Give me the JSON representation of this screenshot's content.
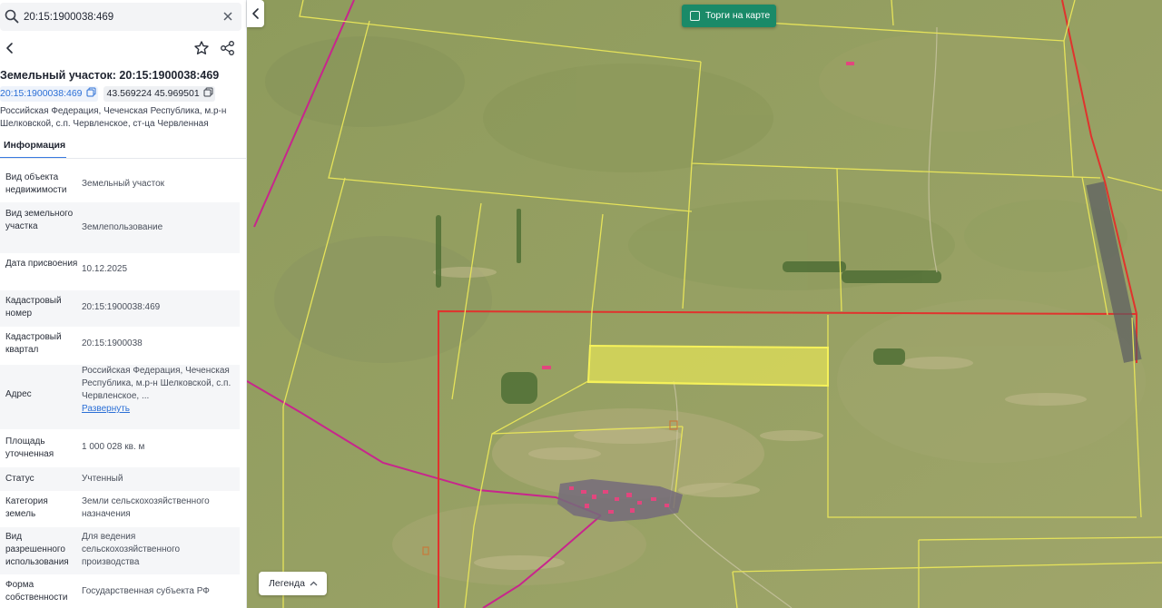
{
  "search": {
    "query": "20:15:1900038:469"
  },
  "card": {
    "title": "Земельный участок: 20:15:1900038:469",
    "cadastral_chip": "20:15:1900038:469",
    "coords_chip": "43.569224 45.969501",
    "address": "Российская Федерация, Чеченская Республика, м.р-н Шелковской, с.п. Червленское, ст-ца Червленная",
    "tab_info": "Информация"
  },
  "info": {
    "rows": [
      {
        "key": "Вид объекта недвижимости",
        "value": "Земельный участок"
      },
      {
        "key": "Вид земельного участка",
        "value": "Землепользование"
      },
      {
        "key": "Дата присвоения",
        "value": "10.12.2025"
      },
      {
        "key": "Кадастровый номер",
        "value": "20:15:1900038:469"
      },
      {
        "key": "Кадастровый квартал",
        "value": "20:15:1900038"
      },
      {
        "key": "Адрес",
        "value": "Российская Федерация, Чеченская Республика, м.р-н Шелковской, с.п. Червленское, ...",
        "link": "Развернуть"
      },
      {
        "key": "Площадь уточненная",
        "value": "1 000 028 кв. м"
      },
      {
        "key": "Статус",
        "value": "Учтенный"
      },
      {
        "key": "Категория земель",
        "value": "Земли сельскохозяйственного назначения"
      },
      {
        "key": "Вид разрешенного использования",
        "value": "Для ведения сельскохозяйственного производства"
      },
      {
        "key": "Форма собственности",
        "value": "Государственная субъекта РФ"
      }
    ]
  },
  "map": {
    "auction_toggle": "Торги на карте",
    "legend_button": "Легенда"
  },
  "icons": {
    "search": "search-icon",
    "clear": "close-icon",
    "back": "chevron-left-icon",
    "favorite": "star-icon",
    "share": "share-icon",
    "copy": "copy-icon",
    "collapse": "chevron-left-icon",
    "legend": "chevron-up-icon"
  },
  "colors": {
    "accent": "#2b6fd6",
    "auction_button": "#1a8a68",
    "parcel_border": "#e6e35a",
    "selected_fill": "#f3f055",
    "quarter_border": "#e0332d",
    "road": "#c8258d"
  }
}
